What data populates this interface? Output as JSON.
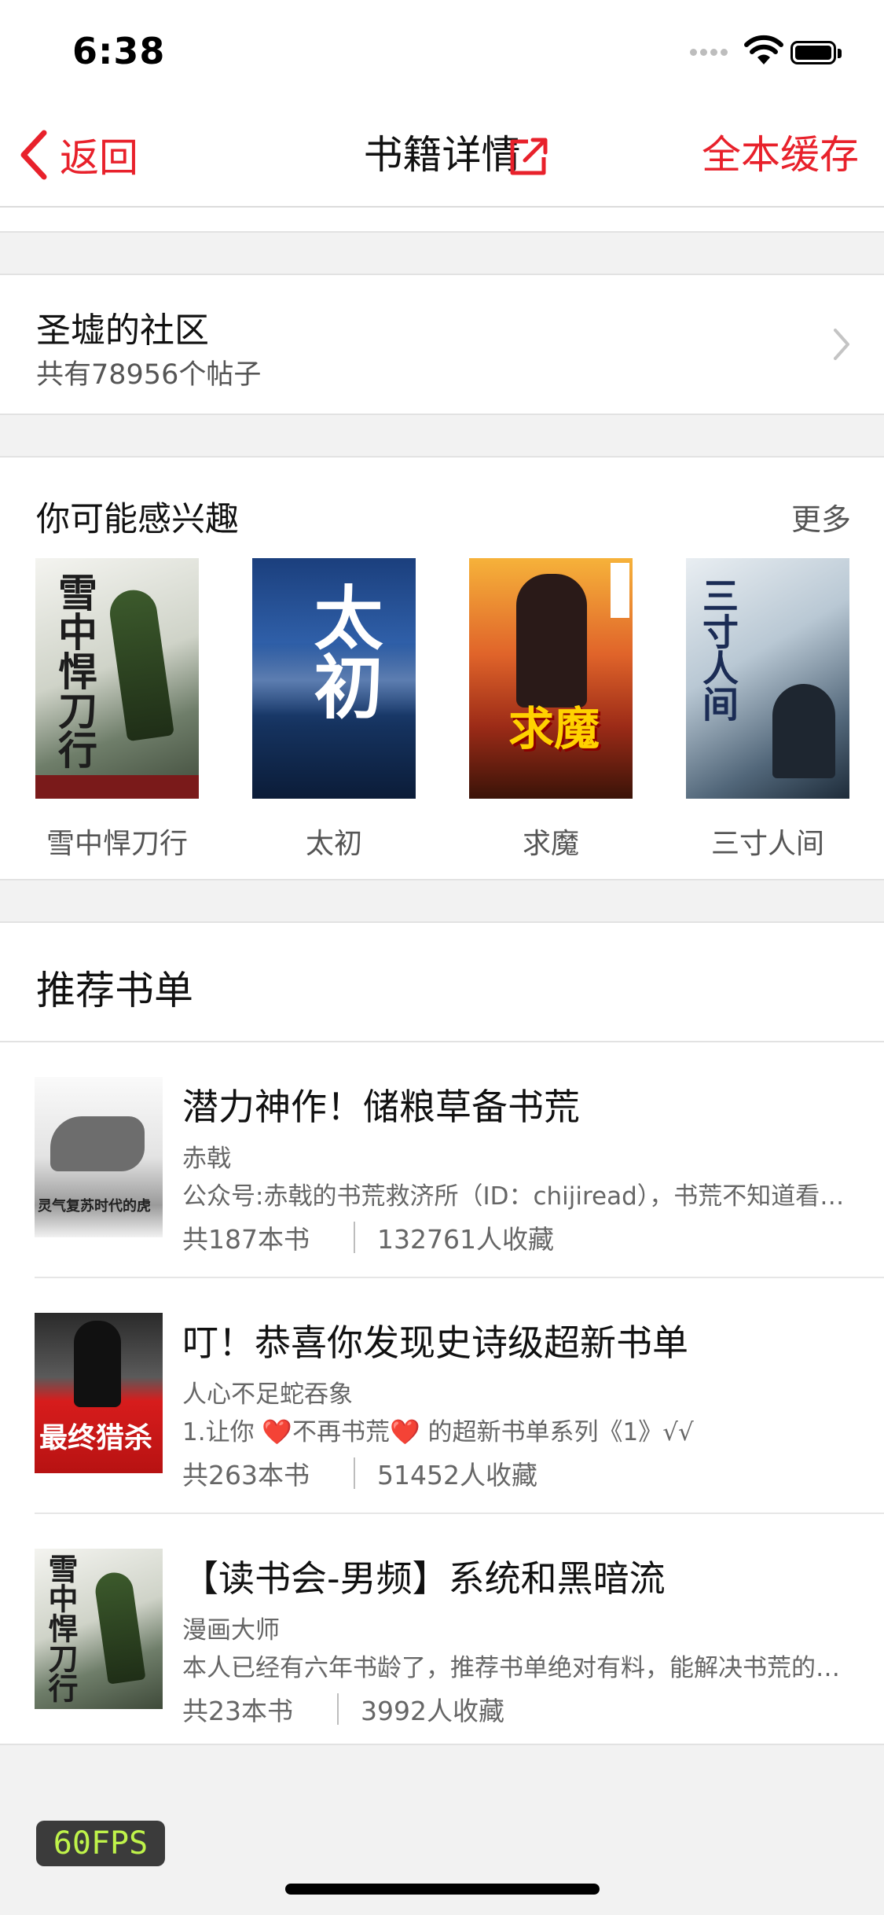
{
  "status": {
    "time": "6:38"
  },
  "nav": {
    "back_label": "返回",
    "title": "书籍详情",
    "cache_label": "全本缓存"
  },
  "community": {
    "name": "圣墟的社区",
    "posts": "共有78956个帖子"
  },
  "interest": {
    "title": "你可能感兴趣",
    "more": "更多",
    "books": [
      {
        "title": "雪中悍刀行",
        "cover_text": "雪中悍刀行"
      },
      {
        "title": "太初",
        "cover_text": "太初"
      },
      {
        "title": "求魔",
        "cover_text": "求魔"
      },
      {
        "title": "三寸人间",
        "cover_text": "三寸人间"
      }
    ]
  },
  "recommend": {
    "title": "推荐书单",
    "lists": [
      {
        "title": "潜力神作！储粮草备书荒",
        "author": "赤戟",
        "desc": "公众号:赤戟的书荒救济所（ID：chijiread），书荒不知道看什么书的朋友可以关注",
        "books": "共187本书",
        "favorites": "132761人收藏",
        "cover_text": "灵气复苏时代的虎"
      },
      {
        "title": "叮！恭喜你发现史诗级超新书单",
        "author": "人心不足蛇吞象",
        "desc": "1.让你 ❤️不再书荒❤️ 的超新书单系列《1》√√",
        "books": "共263本书",
        "favorites": "51452人收藏",
        "cover_text": "最终猎杀"
      },
      {
        "title": "【读书会-男频】系统和黑暗流",
        "author": "漫画大师",
        "desc": "本人已经有六年书龄了，推荐书单绝对有料，能解决书荒的苦恼，欢迎收藏",
        "books": "共23本书",
        "favorites": "3992人收藏",
        "cover_text": "雪中悍刀行"
      }
    ]
  },
  "fps": "60FPS",
  "colors": {
    "accent": "#e8212b",
    "background": "#f2f2f2",
    "fps_text": "#bff34a"
  }
}
